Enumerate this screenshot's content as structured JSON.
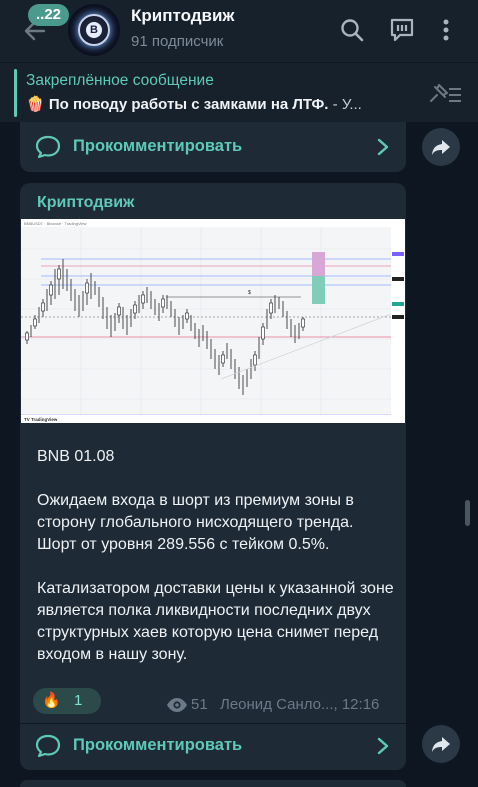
{
  "header": {
    "unread_count": "..22",
    "channel_title": "Криптодвиж",
    "subscribers": "91 подписчик",
    "avatar_letter": "B"
  },
  "pinned": {
    "title": "Закреплённое сообщение",
    "emoji": "🍿",
    "text_bold": "По поводу работы с замками на ЛТФ.",
    "text_rest": " - У..."
  },
  "top_comment_label": "Прокомментировать",
  "post": {
    "author": "Криптодвиж",
    "paragraph1": "BNB 01.08",
    "paragraph2": "Ожидаем входа в шорт из премиум зоны в сторону глобального нисходящего тренда. Шорт от уровня 289.556 с тейком 0.5%.",
    "paragraph3": "Катализатором доставки цены к указанной зоне является полка ликвидности последних двух структурных хаев которую цена снимет перед входом в нашу зону.",
    "reaction_emoji": "🔥",
    "reaction_count": "1",
    "views": "51",
    "signature_time": "Леонид Санло..., 12:16",
    "comment_label": "Прокомментировать"
  },
  "chart_caption": "TV TradingView",
  "colors": {
    "accent": "#5fc9b8",
    "bg": "#0e1621",
    "panel": "#17212b",
    "bubble": "#1e2a36"
  }
}
